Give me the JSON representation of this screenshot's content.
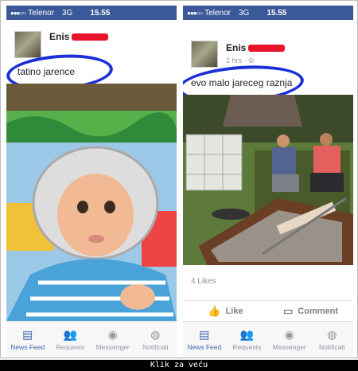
{
  "left": {
    "status": {
      "dots": "●●●○○",
      "carrier": "Telenor",
      "network": "3G",
      "time": "15.55"
    },
    "author": "Enis",
    "caption": "tatino jarence",
    "tabs": [
      {
        "label": "News Feed",
        "icon": "news-feed-icon",
        "active": true
      },
      {
        "label": "Requests",
        "icon": "requests-icon"
      },
      {
        "label": "Messenger",
        "icon": "messenger-icon"
      },
      {
        "label": "Notificati",
        "icon": "globe-icon"
      }
    ]
  },
  "right": {
    "status": {
      "dots": "●●●○○",
      "carrier": "Telenor",
      "network": "3G",
      "time": "15.55"
    },
    "author": "Enis",
    "meta": "2 hrs · ⊘",
    "caption": "evo malo jareceg raznja",
    "likes": "4 Likes",
    "like_label": "Like",
    "comment_label": "Comment",
    "tabs": [
      {
        "label": "News Feed",
        "icon": "news-feed-icon",
        "active": true
      },
      {
        "label": "Requests",
        "icon": "requests-icon"
      },
      {
        "label": "Messenger",
        "icon": "messenger-icon"
      },
      {
        "label": "Notificati",
        "icon": "globe-icon"
      }
    ]
  },
  "footer": "Klik za veću",
  "colors": {
    "fb_blue": "#3b5998",
    "annotation_blue": "#1a2fd8",
    "redact_red": "#e8142b"
  }
}
